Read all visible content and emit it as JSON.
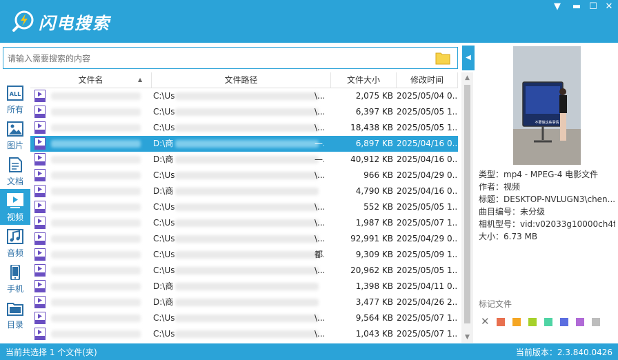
{
  "app": {
    "title": "闪电搜索"
  },
  "search": {
    "placeholder": "请输入需要搜索的内容",
    "value": ""
  },
  "sidebar": [
    {
      "label": "所有",
      "icon": "all-icon"
    },
    {
      "label": "图片",
      "icon": "image-icon"
    },
    {
      "label": "文档",
      "icon": "document-icon"
    },
    {
      "label": "视频",
      "icon": "video-icon",
      "active": true
    },
    {
      "label": "音频",
      "icon": "audio-icon"
    },
    {
      "label": "手机",
      "icon": "phone-icon"
    },
    {
      "label": "目录",
      "icon": "folder-icon"
    }
  ],
  "columns": {
    "name": "文件名",
    "path": "文件路径",
    "size": "文件大小",
    "modified": "修改时间"
  },
  "rows": [
    {
      "path": "C:\\Us",
      "path_tail": "\\...",
      "size": "2,075 KB",
      "modified": "2025/05/04 0..."
    },
    {
      "path": "C:\\Us",
      "path_tail": "\\...",
      "size": "6,397 KB",
      "modified": "2025/05/05 1..."
    },
    {
      "path": "C:\\Us",
      "path_tail": "\\...",
      "size": "18,438 KB",
      "modified": "2025/05/05 1..."
    },
    {
      "path": "D:\\商",
      "path_tail": "—...",
      "size": "6,897 KB",
      "modified": "2025/04/16 0...",
      "selected": true
    },
    {
      "path": "D:\\商",
      "path_tail": "—...",
      "size": "40,912 KB",
      "modified": "2025/04/16 0..."
    },
    {
      "path": "C:\\Us",
      "path_tail": "\\...",
      "size": "966 KB",
      "modified": "2025/04/29 0..."
    },
    {
      "path": "D:\\商",
      "path_tail": "",
      "size": "4,790 KB",
      "modified": "2025/04/16 0..."
    },
    {
      "path": "C:\\Us",
      "path_tail": "\\...",
      "size": "552 KB",
      "modified": "2025/05/05 1..."
    },
    {
      "path": "C:\\Us",
      "path_tail": "\\...",
      "size": "1,987 KB",
      "modified": "2025/05/07 1..."
    },
    {
      "path": "C:\\Us",
      "path_tail": "\\...",
      "size": "92,991 KB",
      "modified": "2025/04/29 0..."
    },
    {
      "path": "C:\\Us",
      "path_tail": "都...",
      "size": "9,309 KB",
      "modified": "2025/05/09 1..."
    },
    {
      "path": "C:\\Us",
      "path_tail": "\\...",
      "size": "20,962 KB",
      "modified": "2025/05/05 1..."
    },
    {
      "path": "D:\\商",
      "path_tail": "",
      "size": "1,398 KB",
      "modified": "2025/04/11 0..."
    },
    {
      "path": "D:\\商",
      "path_tail": "",
      "size": "3,477 KB",
      "modified": "2025/04/26 2..."
    },
    {
      "path": "C:\\Us",
      "path_tail": "\\...",
      "size": "9,564 KB",
      "modified": "2025/05/07 1..."
    },
    {
      "path": "C:\\Us",
      "path_tail": "\\...",
      "size": "1,043 KB",
      "modified": "2025/05/07 1..."
    }
  ],
  "details": {
    "preview_caption": "不要做这些事情",
    "type": "类型：mp4 - MPEG-4 电影文件",
    "author": "作者：视频",
    "title": "标题：DESKTOP-NVLUGN3\\chen...",
    "track": "曲目编号：未分级",
    "camera": "相机型号：vid:v02033g10000ch4f...",
    "size": "大小：6.73 MB"
  },
  "tags": {
    "label": "标记文件",
    "colors": [
      "#e8704f",
      "#f5a623",
      "#a6d12b",
      "#4fd4a4",
      "#5b6ee0",
      "#b06ad6",
      "#bdbdbd"
    ]
  },
  "status": {
    "left": "当前共选择 1 个文件(夹)",
    "right": "当前版本：2.3.840.0426"
  },
  "colors": {
    "accent": "#2ba3d8"
  }
}
